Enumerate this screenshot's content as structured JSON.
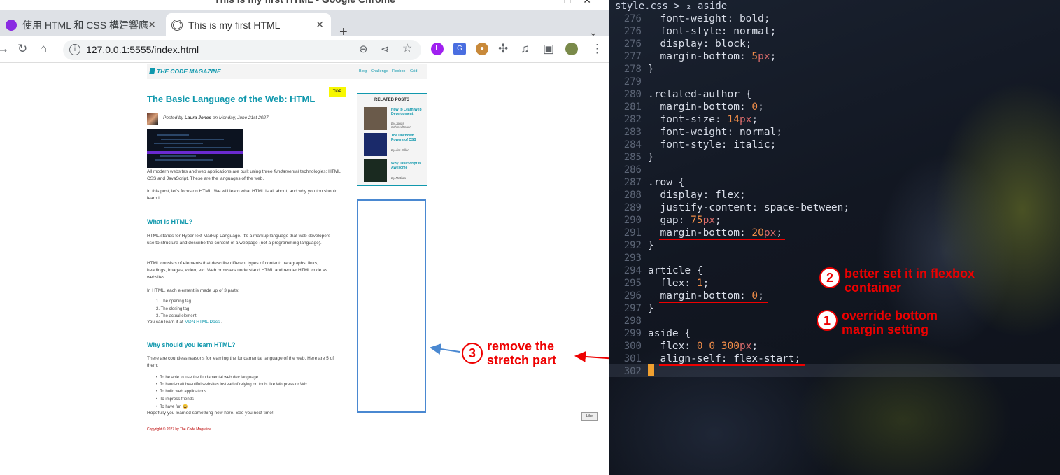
{
  "browser": {
    "window_title": "This is my first HTML - Google Chrome",
    "tabs": [
      {
        "label": "使用 HTML 和 CSS 構建響應"
      },
      {
        "label": "This is my first HTML",
        "active": true
      }
    ],
    "new_tab": "+",
    "url": "127.0.0.1:5555/index.html"
  },
  "site": {
    "logo": "THE CODE MAGAZINE",
    "nav": [
      "Blog",
      "Challenge",
      "Flexbox",
      "Grid"
    ],
    "top_label": "TOP",
    "title": "The Basic Language of the Web: HTML",
    "posted_pre": "Posted by ",
    "author": "Laura Jones",
    "posted_post": " on Monday, June 21st 2027",
    "intro1_a": "All modern websites and web applications are built using three ",
    "intro1_em": "fundamental",
    "intro1_b": " technologies: HTML, CSS and JavaScript. These are the languages of the web.",
    "intro2": "In this post, let's focus on HTML. We will learn what HTML is all about, and why you too should learn it.",
    "h_what": "What is HTML?",
    "what1": "HTML stands for HyperText Markup Language. It's a markup language that web developers use to structure and describe the content of a webpage (not a programming language).",
    "what2": "HTML consists of elements that describe different types of content: paragraphs, links, headings, images, video, etc. Web browsers understand HTML and render HTML code as websites.",
    "what3": "In HTML, each element is made up of 3 parts:",
    "parts": [
      "1. The opening tag",
      "2. The closing tag",
      "3. The actual element"
    ],
    "learn_pre": "You can learn it at ",
    "learn_link": "MDN HTML Docs",
    "learn_post": " .",
    "h_why": "Why should you learn HTML?",
    "why1": "There are countless reasons for learning the fundamental language of the web. Here are 5 of them:",
    "reasons": [
      "To be able to use the fundamental web dev language",
      "To hand-craft beautiful websites instead of relying on tools like Worpress or Wix",
      "To build web applications",
      "To impress friends",
      "To have fun 😀"
    ],
    "outro": "Hopefully you learned something new here. See you next time!",
    "copyright": "Copyright © 2027 by The Code Magazine.",
    "like": "Like",
    "related": {
      "heading": "RELATED POSTS",
      "items": [
        {
          "title": "How to Learn Web Development",
          "author": "By Jonas Schmedtmann",
          "color": "#6a5a4a"
        },
        {
          "title": "The Unknown Powers of CSS",
          "author": "By Jim Dillon",
          "color": "#1a2a6a"
        },
        {
          "title": "Why JavaScript is Awesome",
          "author": "By Matilda",
          "color": "#1a2a20"
        }
      ]
    }
  },
  "editor": {
    "breadcrumb": "style.css > ₂ aside",
    "lines": [
      {
        "n": "276",
        "text": "  font-weight: bold;"
      },
      {
        "n": "276",
        "text": "  font-style: normal;"
      },
      {
        "n": "276",
        "text": "  display: block;"
      },
      {
        "n": "277",
        "text": "  margin-bottom: 5px;"
      },
      {
        "n": "278",
        "text": "}"
      },
      {
        "n": "279",
        "text": ""
      },
      {
        "n": "280",
        "text": ".related-author {"
      },
      {
        "n": "281",
        "text": "  margin-bottom: 0;"
      },
      {
        "n": "282",
        "text": "  font-size: 14px;"
      },
      {
        "n": "283",
        "text": "  font-weight: normal;"
      },
      {
        "n": "284",
        "text": "  font-style: italic;"
      },
      {
        "n": "285",
        "text": "}"
      },
      {
        "n": "286",
        "text": ""
      },
      {
        "n": "287",
        "text": ".row {"
      },
      {
        "n": "288",
        "text": "  display: flex;"
      },
      {
        "n": "289",
        "text": "  justify-content: space-between;"
      },
      {
        "n": "290",
        "text": "  gap: 75px;"
      },
      {
        "n": "291",
        "text": "  margin-bottom: 20px;"
      },
      {
        "n": "292",
        "text": "}"
      },
      {
        "n": "293",
        "text": ""
      },
      {
        "n": "294",
        "text": "article {"
      },
      {
        "n": "295",
        "text": "  flex: 1;"
      },
      {
        "n": "296",
        "text": "  margin-bottom: 0;"
      },
      {
        "n": "297",
        "text": "}"
      },
      {
        "n": "298",
        "text": ""
      },
      {
        "n": "299",
        "text": "aside {"
      },
      {
        "n": "300",
        "text": "  flex: 0 0 300px;"
      },
      {
        "n": "301",
        "text": "  align-self: flex-start;"
      },
      {
        "n": "302",
        "text": "}"
      }
    ]
  },
  "annotations": [
    {
      "num": "1",
      "text": "override bottom\nmargin setting"
    },
    {
      "num": "2",
      "text": "better set it in flexbox\ncontainer"
    },
    {
      "num": "3",
      "text": "remove the\nstretch part"
    }
  ],
  "colors": {
    "accent": "#1098ad",
    "annotation": "#e00000",
    "blue_box": "#4a88d1"
  }
}
